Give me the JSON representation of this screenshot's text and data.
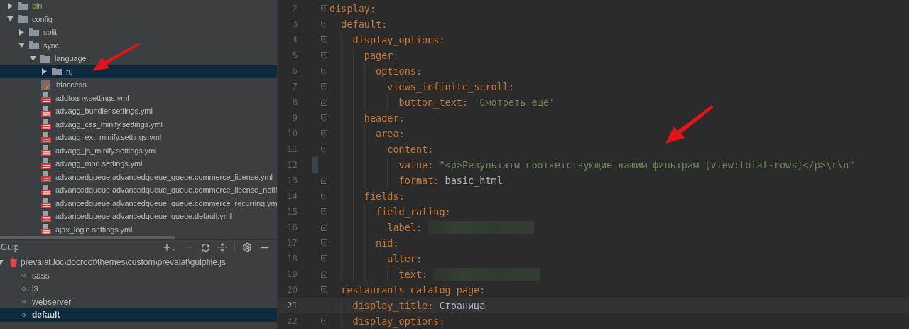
{
  "project_tree": [
    {
      "label": "bin",
      "kind": "folder",
      "expanded": false,
      "excluded": true,
      "selected": false
    },
    {
      "label": "config",
      "kind": "folder",
      "expanded": true,
      "excluded": false,
      "selected": false,
      "children": [
        {
          "label": "split",
          "kind": "folder",
          "expanded": false,
          "excluded": false,
          "selected": false
        },
        {
          "label": "sync",
          "kind": "folder",
          "expanded": true,
          "excluded": false,
          "selected": false,
          "children": [
            {
              "label": "language",
              "kind": "folder",
              "expanded": true,
              "excluded": false,
              "selected": false,
              "children": [
                {
                  "label": "ru",
                  "kind": "folder",
                  "expanded": false,
                  "excluded": false,
                  "selected": true
                }
              ]
            },
            {
              "label": ".htaccess",
              "kind": "htaccess",
              "selected": false
            },
            {
              "label": "addtoany.settings.yml",
              "kind": "yml",
              "selected": false
            },
            {
              "label": "advagg_bundler.settings.yml",
              "kind": "yml",
              "selected": false
            },
            {
              "label": "advagg_css_minify.settings.yml",
              "kind": "yml",
              "selected": false
            },
            {
              "label": "advagg_ext_minify.settings.yml",
              "kind": "yml",
              "selected": false
            },
            {
              "label": "advagg_js_minify.settings.yml",
              "kind": "yml",
              "selected": false
            },
            {
              "label": "advagg_mod.settings.yml",
              "kind": "yml",
              "selected": false
            },
            {
              "label": "advancedqueue.advancedqueue_queue.commerce_license.yml",
              "kind": "yml",
              "selected": false
            },
            {
              "label": "advancedqueue.advancedqueue_queue.commerce_license_notif",
              "kind": "yml",
              "selected": false
            },
            {
              "label": "advancedqueue.advancedqueue_queue.commerce_recurring.ym",
              "kind": "yml",
              "selected": false
            },
            {
              "label": "advancedqueue.advancedqueue_queue.default.yml",
              "kind": "yml",
              "selected": false
            },
            {
              "label": "ajax_login.settings.yml",
              "kind": "yml",
              "selected": false
            }
          ]
        }
      ]
    }
  ],
  "gulp_panel": {
    "title": "Gulp",
    "file": {
      "label": "prevalat.loc\\docroot\\themes\\custom\\prevalat\\gulpfile.js",
      "expanded": true
    },
    "tasks": [
      {
        "label": "sass",
        "selected": false
      },
      {
        "label": "js",
        "selected": false
      },
      {
        "label": "webserver",
        "selected": false
      },
      {
        "label": "default",
        "selected": true
      }
    ]
  },
  "editor_lines": [
    {
      "number": "2",
      "key": "display:",
      "fold_start": true,
      "fold_end": false,
      "current": false,
      "modified": false,
      "children": [
        {
          "number": "3",
          "key": "default:",
          "fold_start": true,
          "fold_end": false,
          "current": false,
          "modified": false,
          "children": [
            {
              "number": "4",
              "key": "display_options:",
              "fold_start": true,
              "fold_end": false,
              "current": false,
              "modified": false,
              "children": [
                {
                  "number": "5",
                  "key": "pager:",
                  "fold_start": true,
                  "fold_end": false,
                  "current": false,
                  "modified": false,
                  "children": [
                    {
                      "number": "6",
                      "key": "options:",
                      "fold_start": true,
                      "fold_end": false,
                      "current": false,
                      "modified": false,
                      "children": [
                        {
                          "number": "7",
                          "key": "views_infinite_scroll:",
                          "fold_start": true,
                          "fold_end": false,
                          "current": false,
                          "modified": false,
                          "children": [
                            {
                              "number": "8",
                              "key": "button_text:",
                              "value": {
                                "kind": "string",
                                "text": "'Смотреть еще'"
                              },
                              "fold_start": false,
                              "fold_end": true,
                              "current": false,
                              "modified": false
                            }
                          ]
                        }
                      ]
                    }
                  ]
                },
                {
                  "number": "9",
                  "key": "header:",
                  "fold_start": true,
                  "fold_end": false,
                  "current": false,
                  "modified": false,
                  "children": [
                    {
                      "number": "10",
                      "key": "area:",
                      "fold_start": true,
                      "fold_end": false,
                      "current": false,
                      "modified": false,
                      "children": [
                        {
                          "number": "11",
                          "key": "content:",
                          "fold_start": true,
                          "fold_end": false,
                          "current": false,
                          "modified": false,
                          "children": [
                            {
                              "number": "12",
                              "key": "value:",
                              "value": {
                                "kind": "string",
                                "text": "\"<p>Результаты соответствующие вашим фильтрам [view:total-rows]</p>\\r\\n\""
                              },
                              "fold_start": false,
                              "fold_end": false,
                              "current": false,
                              "modified": true
                            },
                            {
                              "number": "13",
                              "key": "format:",
                              "value": {
                                "kind": "plain",
                                "text": "basic_html"
                              },
                              "fold_start": false,
                              "fold_end": true,
                              "current": false,
                              "modified": false
                            }
                          ]
                        }
                      ]
                    }
                  ]
                },
                {
                  "number": "14",
                  "key": "fields:",
                  "fold_start": true,
                  "fold_end": false,
                  "current": false,
                  "modified": false,
                  "children": [
                    {
                      "number": "15",
                      "key": "field_rating:",
                      "fold_start": true,
                      "fold_end": false,
                      "current": false,
                      "modified": false,
                      "children": [
                        {
                          "number": "16",
                          "key": "label:",
                          "value": {
                            "kind": "redacted"
                          },
                          "fold_start": false,
                          "fold_end": true,
                          "current": false,
                          "modified": false
                        }
                      ]
                    },
                    {
                      "number": "17",
                      "key": "nid:",
                      "fold_start": true,
                      "fold_end": false,
                      "current": false,
                      "modified": false,
                      "children": [
                        {
                          "number": "18",
                          "key": "alter:",
                          "fold_start": true,
                          "fold_end": false,
                          "current": false,
                          "modified": false,
                          "children": [
                            {
                              "number": "19",
                              "key": "text:",
                              "value": {
                                "kind": "redacted"
                              },
                              "fold_start": false,
                              "fold_end": true,
                              "current": false,
                              "modified": false
                            }
                          ]
                        }
                      ]
                    }
                  ]
                }
              ]
            }
          ]
        },
        {
          "number": "20",
          "key": "restaurants_catalog_page:",
          "fold_start": true,
          "fold_end": false,
          "current": false,
          "modified": false,
          "children": [
            {
              "number": "21",
              "key": "display_title:",
              "value": {
                "kind": "plain",
                "text": "Страница"
              },
              "fold_start": false,
              "fold_end": false,
              "current": true,
              "modified": false
            },
            {
              "number": "22",
              "key": "display_options:",
              "fold_start": true,
              "fold_end": false,
              "current": false,
              "modified": false
            }
          ]
        }
      ]
    }
  ]
}
